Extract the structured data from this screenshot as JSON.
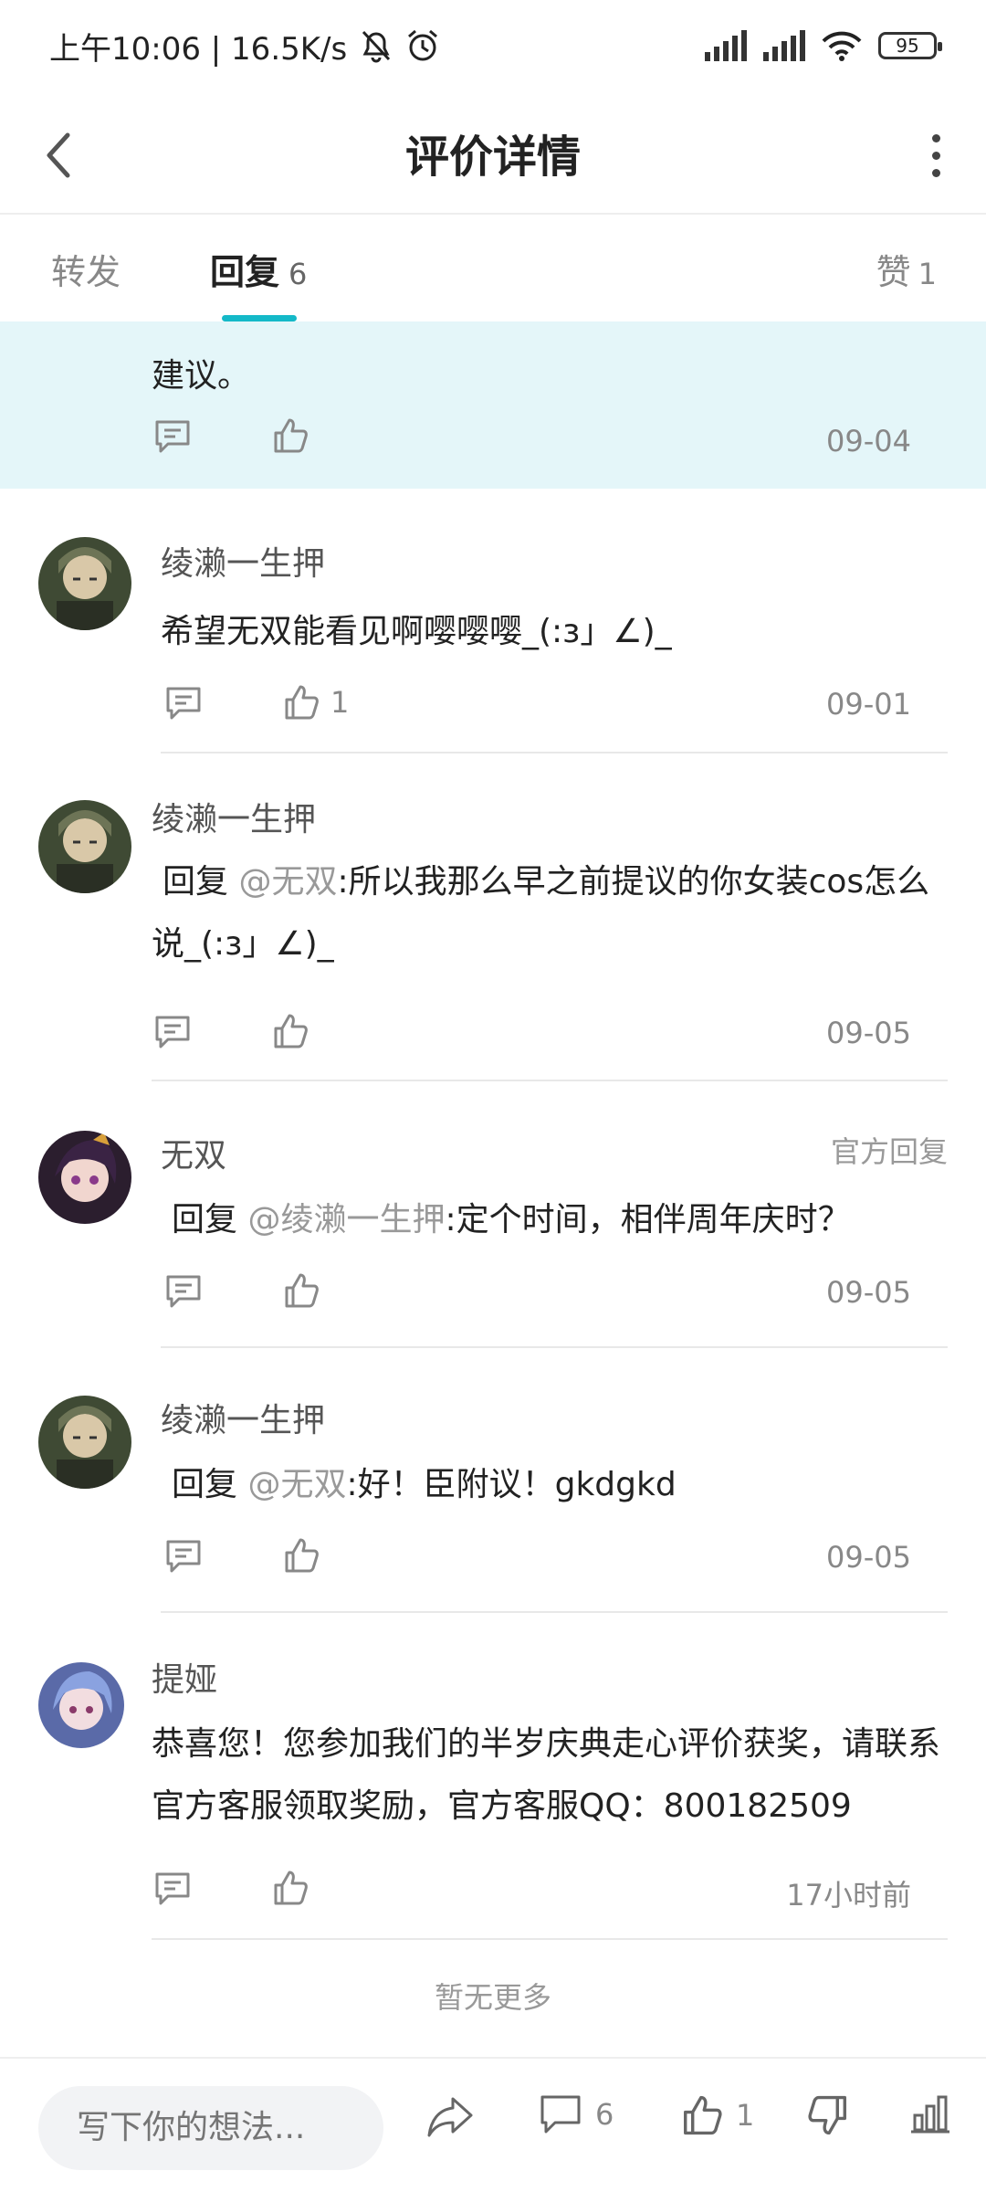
{
  "status_bar": {
    "time": "上午10:06 | 16.5K/s",
    "battery": "95",
    "icons": [
      "bell-off-icon",
      "alarm-icon",
      "signal-icon",
      "wifi-icon",
      "battery-icon"
    ]
  },
  "header": {
    "title": "评价详情"
  },
  "tabs": {
    "repost": "转发",
    "reply": "回复",
    "reply_count": "6",
    "like": "赞",
    "like_count": "1"
  },
  "highlight": {
    "text": "建议。",
    "date": "09-04"
  },
  "replies": [
    {
      "name": "绫濑一生押",
      "content": "希望无双能看见啊嘤嘤嘤_(:з」∠)_",
      "like_count": "1",
      "date": "09-01"
    },
    {
      "name": "绫濑一生押",
      "prefix": "回复 ",
      "mention": "@无双",
      "content": ":所以我那么早之前提议的你女装cos怎么说_(:з」∠)_",
      "date": "09-05"
    },
    {
      "name": "无双",
      "official_label": "官方回复",
      "prefix": "回复 ",
      "mention": "@绫濑一生押",
      "content": ":定个时间，相伴周年庆时？",
      "date": "09-05"
    },
    {
      "name": "绫濑一生押",
      "prefix": "回复 ",
      "mention": "@无双",
      "content": ":好！臣附议！gkdgkd",
      "date": "09-05"
    },
    {
      "name": "提娅",
      "content": "恭喜您！您参加我们的半岁庆典走心评价获奖，请联系官方客服领取奖励，官方客服QQ：800182509",
      "date": "17小时前"
    }
  ],
  "no_more": "暂无更多",
  "bottom_bar": {
    "input_placeholder": "写下你的想法...",
    "comment_count": "6",
    "like_count": "1"
  },
  "colors": {
    "accent": "#14b9c8",
    "highlight_bg": "#e4f6f9"
  }
}
